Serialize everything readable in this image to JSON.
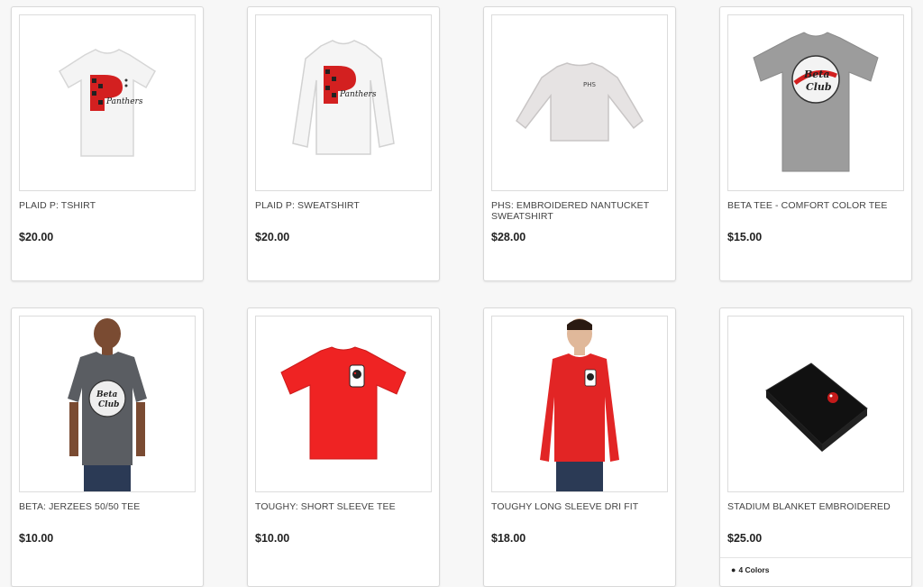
{
  "products": [
    {
      "title": "PLAID P: TSHIRT",
      "price": "$20.00",
      "image": "white-tshirt-plaid-p-panthers"
    },
    {
      "title": "PLAID P: SWEATSHIRT",
      "price": "$20.00",
      "image": "white-sweatshirt-plaid-p-panthers"
    },
    {
      "title": "PHS: EMBROIDERED NANTUCKET SWEATSHIRT",
      "price": "$28.00",
      "image": "grey-sweatshirt-phs",
      "image_text": "PHS"
    },
    {
      "title": "BETA TEE - COMFORT COLOR TEE",
      "price": "$15.00",
      "image": "grey-tshirt-beta-club"
    },
    {
      "title": "BETA: JERZEES 50/50 TEE",
      "price": "$10.00",
      "image": "charcoal-tee-beta-club-model"
    },
    {
      "title": "TOUGHY: SHORT SLEEVE TEE",
      "price": "$10.00",
      "image": "red-tshirt-toughy-logo"
    },
    {
      "title": "TOUGHY LONG SLEEVE DRI FIT",
      "price": "$18.00",
      "image": "red-longsleeve-model"
    },
    {
      "title": "STADIUM BLANKET EMBROIDERED",
      "price": "$25.00",
      "image": "black-blanket-embroidered",
      "colors_label": "4 Colors"
    }
  ],
  "colors": {
    "red": "#e02020",
    "grey": "#a9a9a9",
    "charcoal": "#5a5d62",
    "black": "#151515"
  }
}
